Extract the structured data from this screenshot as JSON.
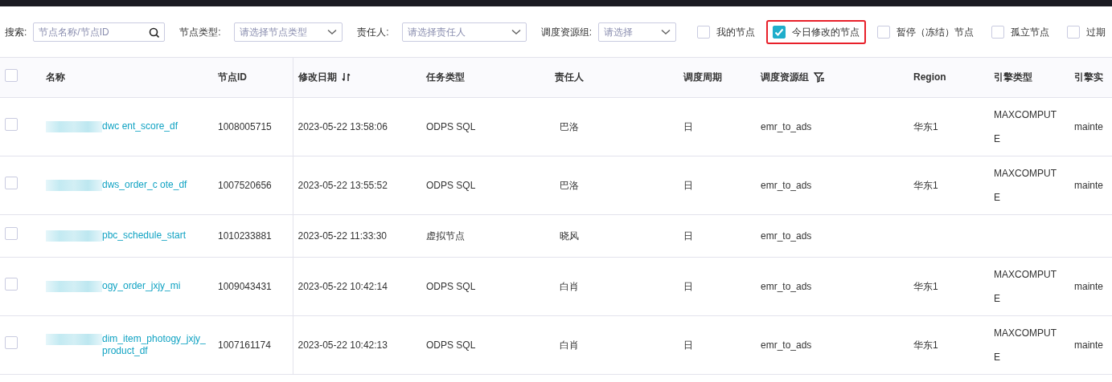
{
  "filters": {
    "search": {
      "label": "搜索:",
      "placeholder": "节点名称/节点ID"
    },
    "selects": [
      {
        "label": "节点类型:",
        "placeholder": "请选择节点类型"
      },
      {
        "label": "责任人:",
        "placeholder": "请选择责任人"
      },
      {
        "label": "调度资源组:",
        "placeholder": "请选择"
      }
    ],
    "checkboxes": [
      {
        "label": "我的节点",
        "checked": false
      },
      {
        "label": "今日修改的节点",
        "checked": true,
        "highlighted": true
      },
      {
        "label": "暂停（冻结）节点",
        "checked": false
      },
      {
        "label": "孤立节点",
        "checked": false
      },
      {
        "label": "过期",
        "checked": false
      }
    ]
  },
  "table": {
    "select_all": {
      "checked": false
    },
    "columns": [
      {
        "label": "名称",
        "kind": "plain"
      },
      {
        "label": "节点ID",
        "kind": "plain"
      },
      {
        "label": "修改日期",
        "kind": "sortable"
      },
      {
        "label": "任务类型",
        "kind": "plain"
      },
      {
        "label": "责任人",
        "kind": "plain"
      },
      {
        "label": "调度周期",
        "kind": "plain"
      },
      {
        "label": "调度资源组",
        "kind": "filterable"
      },
      {
        "label": "Region",
        "kind": "plain"
      },
      {
        "label": "引擎类型",
        "kind": "plain"
      },
      {
        "label": "引擎实",
        "kind": "plain"
      }
    ],
    "rows": [
      {
        "selected": false,
        "name_prefix": "dwc",
        "name": "ent_score_df",
        "redacted": true,
        "id": "1008005715",
        "modified": "2023-05-22 13:58:06",
        "task_type": "ODPS SQL",
        "owner": "巴洛",
        "period": "日",
        "group": "emr_to_ads",
        "region": "华东1",
        "engine": "MAXCOMPUTE",
        "column_10": "mainte"
      },
      {
        "selected": false,
        "name_prefix": "dws_order_c",
        "name": "ote_df",
        "redacted": true,
        "id": "1007520656",
        "modified": "2023-05-22 13:55:52",
        "task_type": "ODPS SQL",
        "owner": "巴洛",
        "period": "日",
        "group": "emr_to_ads",
        "region": "华东1",
        "engine": "MAXCOMPUTE",
        "column_10": "mainte"
      },
      {
        "selected": false,
        "name_prefix": "",
        "name": "pbc_schedule_start",
        "redacted": true,
        "id": "1010233881",
        "modified": "2023-05-22 11:33:30",
        "task_type": "虚拟节点",
        "owner": "晓风",
        "period": "日",
        "group": "emr_to_ads"
      },
      {
        "selected": false,
        "name_prefix": "",
        "name": "ogy_order_jxjy_mi",
        "redacted": true,
        "id": "1009043431",
        "modified": "2023-05-22 10:42:14",
        "task_type": "ODPS SQL",
        "owner": "白肖",
        "period": "日",
        "group": "emr_to_ads",
        "region": "华东1",
        "engine": "MAXCOMPUTE",
        "column_10": "mainte"
      },
      {
        "selected": false,
        "name_prefix": "",
        "name": "dim_item_photogy_jxjy_product_df",
        "redacted": true,
        "id": "1007161174",
        "modified": "2023-05-22 10:42:13",
        "task_type": "ODPS SQL",
        "owner": "白肖",
        "period": "日",
        "group": "emr_to_ads",
        "region": "华东1",
        "engine": "MAXCOMPUTE",
        "column_10": "mainte"
      }
    ]
  }
}
